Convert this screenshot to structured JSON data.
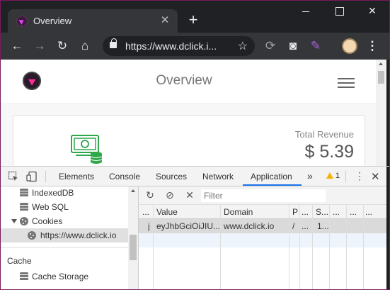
{
  "browser": {
    "tab_title": "Overview",
    "url": "https://www.dclick.i..."
  },
  "page": {
    "title": "Overview",
    "revenue_label": "Total Revenue",
    "revenue_value": "$ 5.39"
  },
  "devtools": {
    "tabs": [
      "Elements",
      "Console",
      "Sources",
      "Network",
      "Application"
    ],
    "active_tab": "Application",
    "more_tabs": "»",
    "warning_count": "1",
    "sidebar": {
      "items": [
        {
          "label": "IndexedDB",
          "icon": "database-icon"
        },
        {
          "label": "Web SQL",
          "icon": "database-icon"
        },
        {
          "label": "Cookies",
          "icon": "cookie-icon",
          "expanded": true
        },
        {
          "label": "https://www.dclick.io",
          "icon": "cookie-icon",
          "selected": true
        }
      ],
      "cache_section": "Cache",
      "cache_items": [
        {
          "label": "Cache Storage",
          "icon": "database-icon"
        }
      ]
    },
    "filter_placeholder": "Filter",
    "table": {
      "headers": [
        "...",
        "Value",
        "Domain",
        "P",
        "...",
        "S...",
        "...",
        "...",
        "..."
      ],
      "rows": [
        [
          "j",
          "eyJhbGciOiJIU...",
          "www.dclick.io",
          "/",
          "...",
          "1...",
          "",
          "",
          ""
        ]
      ]
    }
  }
}
